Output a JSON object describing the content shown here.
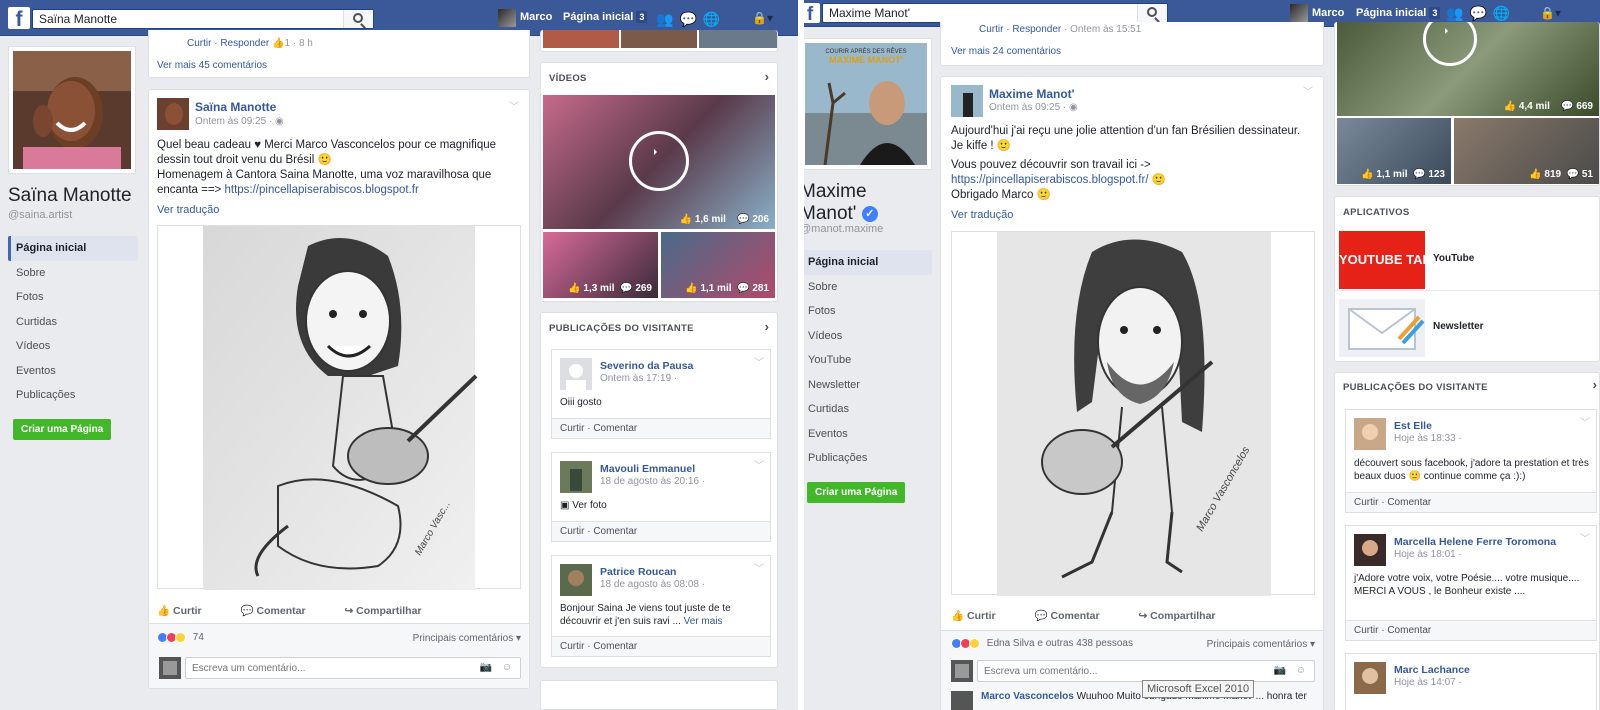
{
  "left": {
    "search_value": "Saïna Manotte",
    "nav_user": "Marco",
    "nav_home": "Página inicial",
    "nav_home_badge": "3",
    "page_name": "Saïna Manotte",
    "handle": "@saina.artist",
    "sidenav": [
      "Página inicial",
      "Sobre",
      "Fotos",
      "Curtidas",
      "Vídeos",
      "Eventos",
      "Publicações"
    ],
    "create_page": "Criar uma Página",
    "prev_comment_actions": "Curtir · Responder",
    "prev_comment_likes": "1",
    "prev_comment_time": "8 h",
    "more_comments": "Ver mais 45 comentários",
    "post": {
      "author": "Saïna Manotte",
      "time": "Ontem às 09:25 ·",
      "text1": "Quel beau cadeau ♥ Merci Marco Vasconcelos pour ce magnifique dessin tout droit venu du Brésil 🙂",
      "text2": "Homenagem à Cantora Saina Manotte, uma voz maravilhosa que encanta ==>",
      "link": "https://pincellapiserabiscos.blogspot.fr",
      "translate": "Ver tradução",
      "like": "Curtir",
      "comment": "Comentar",
      "share": "Compartilhar",
      "reactions": "74",
      "top_comments": "Principais comentários ▾",
      "comment_placeholder": "Escreva um comentário..."
    },
    "videos": {
      "title": "VÍDEOS",
      "main_likes": "1,6 mil",
      "main_comments": "206",
      "v2_likes": "1,3 mil",
      "v2_comments": "269",
      "v3_likes": "1,1 mil",
      "v3_comments": "281"
    },
    "visitor": {
      "title": "PUBLICAÇÕES DO VISITANTE",
      "posts": [
        {
          "name": "Severino da Pausa",
          "time": "Ontem às 17:19 ·",
          "text": "Oiii gosto",
          "foot": "Curtir · Comentar"
        },
        {
          "name": "Mavouli Emmanuel",
          "time": "18 de agosto às 20:16 ·",
          "text": "Ver foto",
          "foot": "Curtir · Comentar"
        },
        {
          "name": "Patrice Roucan",
          "time": "18 de agosto às 08:08 ·",
          "text": "Bonjour Saina Je viens tout juste de te découvrir et j'en suis ravi ...",
          "more": "Ver mais",
          "foot": "Curtir · Comentar"
        }
      ]
    }
  },
  "right": {
    "search_value": "Maxime Manot'",
    "nav_user": "Marco",
    "nav_home": "Página inicial",
    "nav_home_badge": "3",
    "cover_text1": "COURIR APRÈS DES RÊVES",
    "cover_text2": "MAXIME MANOT'",
    "page_name_line1": "Maxime",
    "page_name_line2": "Manot'",
    "handle": "@manot.maxime",
    "sidenav": [
      "Página inicial",
      "Sobre",
      "Fotos",
      "Vídeos",
      "YouTube",
      "Newsletter",
      "Curtidas",
      "Eventos",
      "Publicações"
    ],
    "create_page": "Criar uma Página",
    "prev_comment_actions": "Curtir · Responder",
    "prev_comment_time": "Ontem às 15:51",
    "more_comments": "Ver mais 24 comentários",
    "post": {
      "author": "Maxime Manot'",
      "time": "Ontem às 09:25 ·",
      "text1": "Aujourd'hui j'ai reçu une jolie attention d'un fan Brésilien dessinateur. Je kiffe ! 🙂",
      "text2": "Vous pouvez découvrir son travail ici ->",
      "link": "https://pincellapiserabiscos.blogspot.fr/",
      "text3": "Obrigado Marco 🙂",
      "translate": "Ver tradução",
      "like": "Curtir",
      "comment": "Comentar",
      "share": "Compartilhar",
      "reactions": "Edna Silva e outras 438 pessoas",
      "top_comments": "Principais comentários ▾",
      "comment_placeholder": "Escreva um comentário...",
      "next_comment_author": "Marco Vasconcelos",
      "next_comment_text": "Wuuhoo Muito obrigado Maxime Manot' ... honra ter"
    },
    "videos": {
      "top_likes": "4,4 mil",
      "top_comments": "669",
      "v2_likes": "1,1 mil",
      "v2_comments": "123",
      "v3_likes": "819",
      "v3_comments": "51"
    },
    "apps": {
      "title": "APLICATIVOS",
      "youtube_tile": "YOUTUBE TAB",
      "youtube": "YouTube",
      "newsletter": "Newsletter"
    },
    "visitor": {
      "title": "PUBLICAÇÕES DO VISITANTE",
      "posts": [
        {
          "name": "Est Elle",
          "time": "Hoje às 18:33 ·",
          "text": "découvert sous facebook, j'adore ta prestation et très beaux duos 🙂 continue comme ça :):)",
          "foot": "Curtir · Comentar"
        },
        {
          "name": "Marcella Helene Ferre Toromona",
          "time": "Hoje às 18:01 ·",
          "text": "j'Adore votre voix, votre Poésie.... votre musique.... MERCI A VOUS , le Bonheur existe ....",
          "foot": "Curtir · Comentar"
        },
        {
          "name": "Marc Lachance",
          "time": "Hoje às 14:07 ·"
        }
      ]
    },
    "tooltip": "Microsoft Excel 2010"
  }
}
